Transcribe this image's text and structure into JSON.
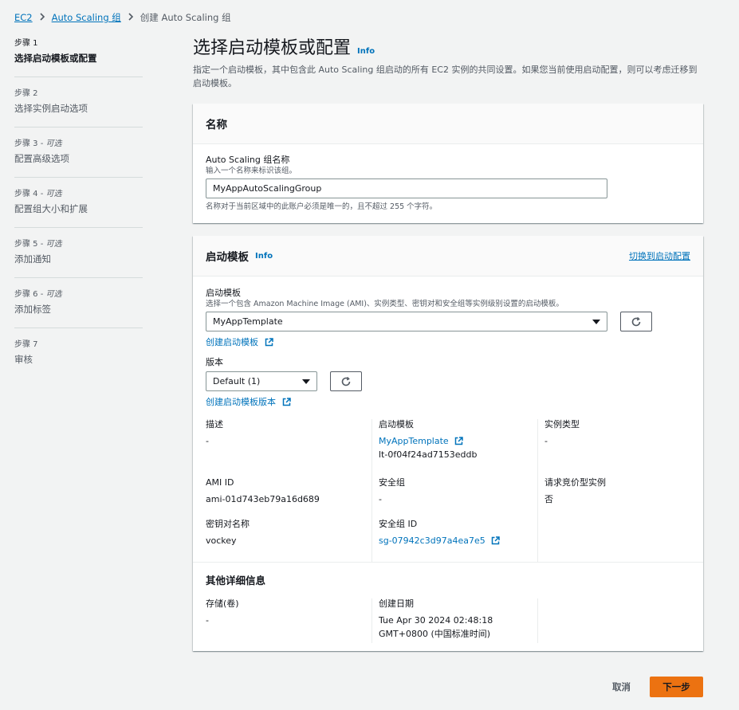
{
  "breadcrumb": {
    "items": [
      "EC2",
      "Auto Scaling 组"
    ],
    "current": "创建 Auto Scaling 组"
  },
  "sidebar": {
    "steps": [
      {
        "num": "步骤 1",
        "optional": "",
        "title": "选择启动模板或配置"
      },
      {
        "num": "步骤 2",
        "optional": "",
        "title": "选择实例启动选项"
      },
      {
        "num": "步骤 3 - ",
        "optional": "可选",
        "title": "配置高级选项"
      },
      {
        "num": "步骤 4 - ",
        "optional": "可选",
        "title": "配置组大小和扩展"
      },
      {
        "num": "步骤 5 - ",
        "optional": "可选",
        "title": "添加通知"
      },
      {
        "num": "步骤 6 - ",
        "optional": "可选",
        "title": "添加标签"
      },
      {
        "num": "步骤 7",
        "optional": "",
        "title": "审核"
      }
    ]
  },
  "page": {
    "title": "选择启动模板或配置",
    "info": "Info",
    "description": "指定一个启动模板，其中包含此 Auto Scaling 组启动的所有 EC2 实例的共同设置。如果您当前使用启动配置，则可以考虑迁移到启动模板。"
  },
  "name_panel": {
    "title": "名称",
    "field_label": "Auto Scaling 组名称",
    "field_desc": "输入一个名称来标识该组。",
    "field_value": "MyAppAutoScalingGroup",
    "field_hint": "名称对于当前区域中的此账户必须是唯一的，且不超过 255 个字符。"
  },
  "template_panel": {
    "title": "启动模板",
    "info": "Info",
    "switch_link": "切换到启动配置",
    "template_label": "启动模板",
    "template_desc": "选择一个包含 Amazon Machine Image (AMI)、实例类型、密钥对和安全组等实例级别设置的启动模板。",
    "template_value": "MyAppTemplate",
    "create_template_link": "创建启动模板",
    "version_label": "版本",
    "version_value": "Default (1)",
    "create_version_link": "创建启动模板版本",
    "details": {
      "description_label": "描述",
      "description_value": "-",
      "launch_template_label": "启动模板",
      "launch_template_name": "MyAppTemplate",
      "launch_template_id": "lt-0f04f24ad7153eddb",
      "instance_type_label": "实例类型",
      "instance_type_value": "-",
      "ami_label": "AMI ID",
      "ami_value": "ami-01d743eb79a16d689",
      "security_groups_label": "安全组",
      "security_groups_value": "-",
      "spot_label": "请求竞价型实例",
      "spot_value": "否",
      "key_pair_label": "密钥对名称",
      "key_pair_value": "vockey",
      "sg_id_label": "安全组 ID",
      "sg_id_value": "sg-07942c3d97a4ea7e5"
    },
    "additional": {
      "title": "其他详细信息",
      "storage_label": "存储(卷)",
      "storage_value": "-",
      "created_label": "创建日期",
      "created_value_1": "Tue Apr 30 2024 02:48:18",
      "created_value_2": "GMT+0800 (中国标准时间)"
    }
  },
  "footer": {
    "cancel": "取消",
    "next": "下一步"
  },
  "colors": {
    "link": "#0073bb",
    "primary_button": "#ec7211",
    "background": "#f2f3f3"
  }
}
